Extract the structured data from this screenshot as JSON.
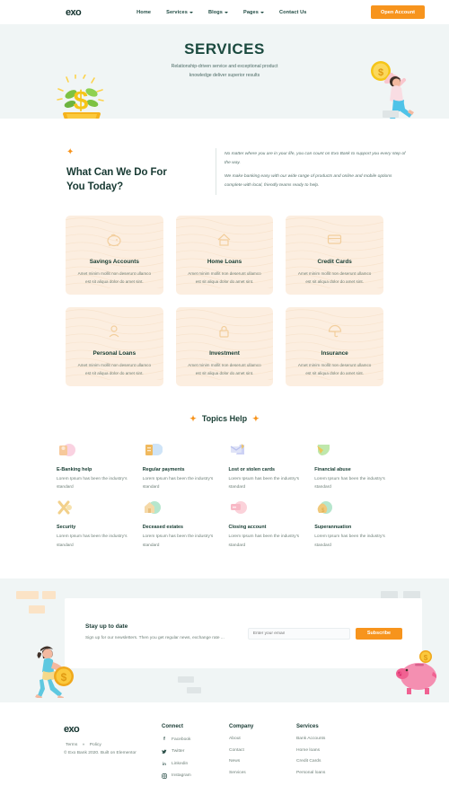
{
  "header": {
    "logo": "exo",
    "nav": [
      {
        "label": "Home",
        "caret": false
      },
      {
        "label": "Services",
        "caret": true
      },
      {
        "label": "Blogs",
        "caret": true
      },
      {
        "label": "Pages",
        "caret": true
      },
      {
        "label": "Contact Us",
        "caret": false
      }
    ],
    "cta_label": "Open Account"
  },
  "hero": {
    "title": "SERVICES",
    "subtitle_line1": "Relationship-driven service and exceptional product",
    "subtitle_line2": "knowledge deliver superior results",
    "art_left": "money-plant-illustration",
    "art_right": "person-climbing-steps-with-coin-illustration",
    "bg_color": "#f0f5f5"
  },
  "intro": {
    "spark": "✦",
    "title_line1": "What Can We Do For",
    "title_line2": "You Today?",
    "paragraphs": [
      "No matter where you are in your life, you can count on Exo Bank to support you every step of the way.",
      "We make banking easy with our wide range of products and online and mobile options complete with local, friendly teams ready to help."
    ]
  },
  "services": {
    "body_text": "Amet minim mollit non deserunt ullamco est sit aliqua dolor do amet sint.",
    "card_bg": "#fceee0",
    "cards": [
      {
        "title": "Savings Accounts",
        "icon": "piggy-bank-icon"
      },
      {
        "title": "Home Loans",
        "icon": "house-icon"
      },
      {
        "title": "Credit Cards",
        "icon": "credit-card-icon"
      },
      {
        "title": "Personal Loans",
        "icon": "person-icon"
      },
      {
        "title": "Investment",
        "icon": "lock-icon"
      },
      {
        "title": "Insurance",
        "icon": "umbrella-icon"
      }
    ]
  },
  "topics": {
    "heading": "Topics Help",
    "spark_left": "✦",
    "spark_right": "✦",
    "body_text": "Lorem Ipsum has been the industry's standard",
    "items": [
      {
        "title": "E-Banking help",
        "icon": "ebanking-icon",
        "color": "#f7c6d9"
      },
      {
        "title": "Regular payments",
        "icon": "calendar-payment-icon",
        "color": "#bcd9f2"
      },
      {
        "title": "Lost or stolen cards",
        "icon": "card-alert-icon",
        "color": "#c7cdf2"
      },
      {
        "title": "Financial abuse",
        "icon": "shield-leaf-icon",
        "color": "#b8e6b0"
      },
      {
        "title": "Security",
        "icon": "key-icon",
        "color": "#f5d98a"
      },
      {
        "title": "Deceased estates",
        "icon": "estate-icon",
        "color": "#a9e3c8"
      },
      {
        "title": "Closing account",
        "icon": "close-account-icon",
        "color": "#f7b9c4"
      },
      {
        "title": "Superannuation",
        "icon": "money-bag-icon",
        "color": "#a9dfc8"
      }
    ]
  },
  "newsletter": {
    "title": "Stay up to date",
    "text": "Sign up for our newsletters. Then you get regular news, exchange rate ...",
    "input_placeholder": "Enter your email",
    "button_label": "Subscribe",
    "art_left": "person-running-with-coin-illustration",
    "art_right": "piggy-bank-illustration",
    "bg_color": "#f0f5f5",
    "accent_color": "#f7941d"
  },
  "footer": {
    "logo": "exo",
    "terms": "Terms",
    "separator": "»",
    "policy": "Policy",
    "copyright": "© Exo Bank 2020. Built on Elementor",
    "columns": [
      {
        "title": "Connect",
        "items": [
          {
            "label": "Facebook",
            "icon": "facebook-icon",
            "glyph": "f"
          },
          {
            "label": "Twitter",
            "icon": "twitter-icon",
            "glyph": "🐦"
          },
          {
            "label": "Linkedin",
            "icon": "linkedin-icon",
            "glyph": "in"
          },
          {
            "label": "Instagram",
            "icon": "instagram-icon",
            "glyph": "▣"
          }
        ]
      },
      {
        "title": "Company",
        "items": [
          {
            "label": "About"
          },
          {
            "label": "Contact"
          },
          {
            "label": "News"
          },
          {
            "label": "Services"
          }
        ]
      },
      {
        "title": "Services",
        "items": [
          {
            "label": "Bank Accounts"
          },
          {
            "label": "Home loans"
          },
          {
            "label": "Credit Cards"
          },
          {
            "label": "Personal loans"
          }
        ]
      }
    ]
  }
}
